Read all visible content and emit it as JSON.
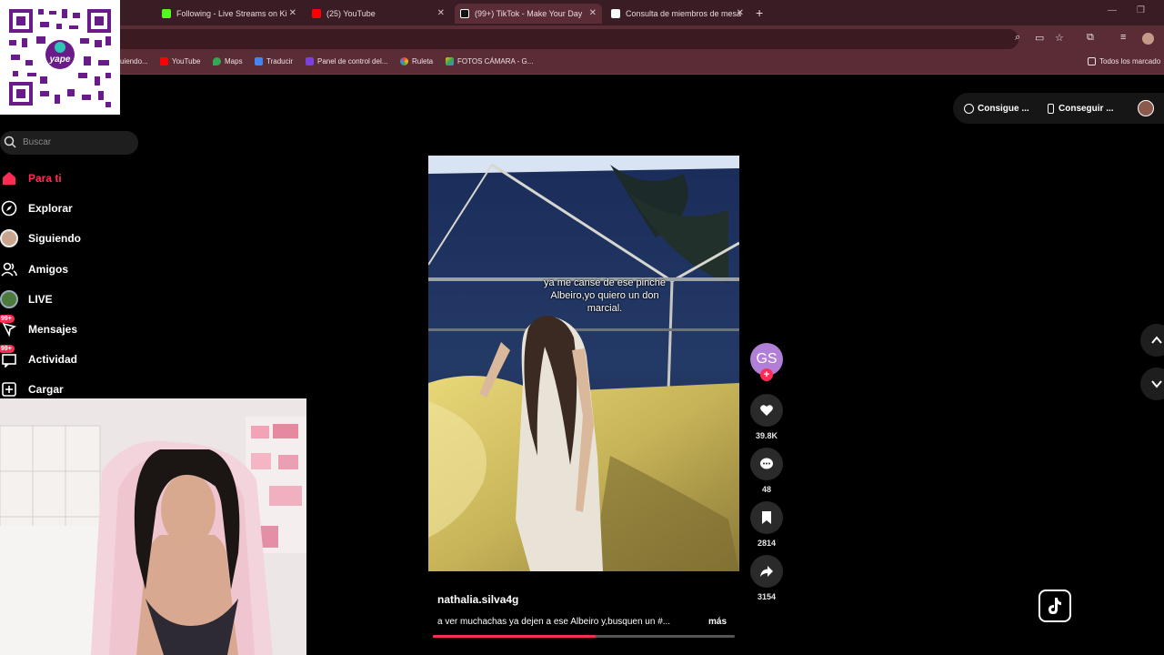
{
  "browser": {
    "tabs": [
      {
        "title": "Following - Live Streams on Ki",
        "color": "#53fc18"
      },
      {
        "title": "(25) YouTube",
        "color": "#ff0000"
      },
      {
        "title": "(99+) TikTok - Make Your Day",
        "color": "#111111"
      },
      {
        "title": "Consulta de miembros de mesa",
        "color": "#ffffff"
      }
    ],
    "new_tab": "+",
    "bookmarks": [
      {
        "label": "uiendo...",
        "color": "#888888"
      },
      {
        "label": "YouTube",
        "color": "#ff0000"
      },
      {
        "label": "Maps",
        "color": "#34a853"
      },
      {
        "label": "Traducir",
        "color": "#4285f4"
      },
      {
        "label": "Panel de control del...",
        "color": "#7b3fe4"
      },
      {
        "label": "Ruleta",
        "color": "#ea4335"
      },
      {
        "label": "FOTOS CÁMARA - G...",
        "color": "#fbbc05"
      }
    ],
    "all_bookmarks": "Todos los marcado"
  },
  "qr": {
    "brand": "yape"
  },
  "sidebar": {
    "search_placeholder": "Buscar",
    "items": [
      {
        "label": "Para ti",
        "icon": "home-icon"
      },
      {
        "label": "Explorar",
        "icon": "compass-icon"
      },
      {
        "label": "Siguiendo",
        "icon": "avatar-icon"
      },
      {
        "label": "Amigos",
        "icon": "friends-icon"
      },
      {
        "label": "LIVE",
        "icon": "live-icon"
      },
      {
        "label": "Mensajes",
        "icon": "messages-icon",
        "badge": "99+"
      },
      {
        "label": "Actividad",
        "icon": "activity-icon",
        "badge": "99+"
      },
      {
        "label": "Cargar",
        "icon": "upload-icon"
      }
    ]
  },
  "topbar": {
    "get_coins": "Consigue ...",
    "get_app": "Conseguir ..."
  },
  "video": {
    "caption": "ya me cansé de ese pinche Albeiro,yo quiero un don marcial.",
    "username": "nathalia.silva4g",
    "description": "a ver muchachas ya dejen a ese Albeiro y,busquen un #...",
    "more": "más",
    "progress": 0.54,
    "creator_initials": "GS"
  },
  "actions": {
    "likes": "39.8K",
    "comments": "48",
    "saves": "2814",
    "shares": "3154"
  },
  "colors": {
    "accent": "#fe2c55",
    "browser_frame": "#5a2c36"
  }
}
